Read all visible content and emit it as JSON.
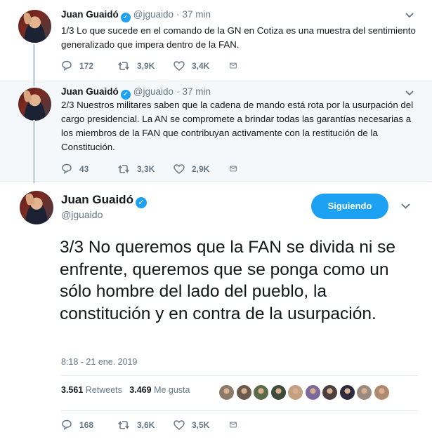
{
  "tweets": [
    {
      "name": "Juan Guaidó",
      "handle": "@jguaido",
      "time": "37 min",
      "text": "1/3 Lo que sucede en el comando de la GN en Cotiza es una muestra del sentimiento generalizado que impera dentro de la FAN.",
      "replies": "172",
      "retweets": "3,9K",
      "likes": "3,4K"
    },
    {
      "name": "Juan Guaidó",
      "handle": "@jguaido",
      "time": "37 min",
      "text": "2/3 Nuestros militares saben que la cadena de mando está rota por la usurpación del cargo presidencial. La AN se compromete a brindar todas las garantías necesarias a los miembros de la FAN que contribuyan activamente con la restitución de la Constitución.",
      "replies": "43",
      "retweets": "3,3K",
      "likes": "2,9K"
    }
  ],
  "main_tweet": {
    "name": "Juan Guaidó",
    "handle": "@jguaido",
    "follow_label": "Siguiendo",
    "text": "3/3  No queremos que la FAN se divida ni se enfrente, queremos que se ponga como un sólo hombre del lado del pueblo, la constitución y en contra de la usurpación.",
    "timestamp": "8:18 - 21 ene. 2019",
    "retweet_count": "3.561",
    "retweet_label": "Retweets",
    "like_count": "3.469",
    "like_label": "Me gusta",
    "replies": "168",
    "retweets": "3,6K",
    "likes": "3,5K"
  },
  "colors": {
    "accent": "#1da1f2",
    "muted": "#657786",
    "thread_bg": "#f5f8fa"
  },
  "liker_colors": [
    "#8a7a6a",
    "#6b5a4e",
    "#5a6b4a",
    "#3e4a3a",
    "#c2a080",
    "#7a6a9a",
    "#4a3e3e",
    "#2e2a3e",
    "#9a8a80",
    "#b08a70"
  ]
}
